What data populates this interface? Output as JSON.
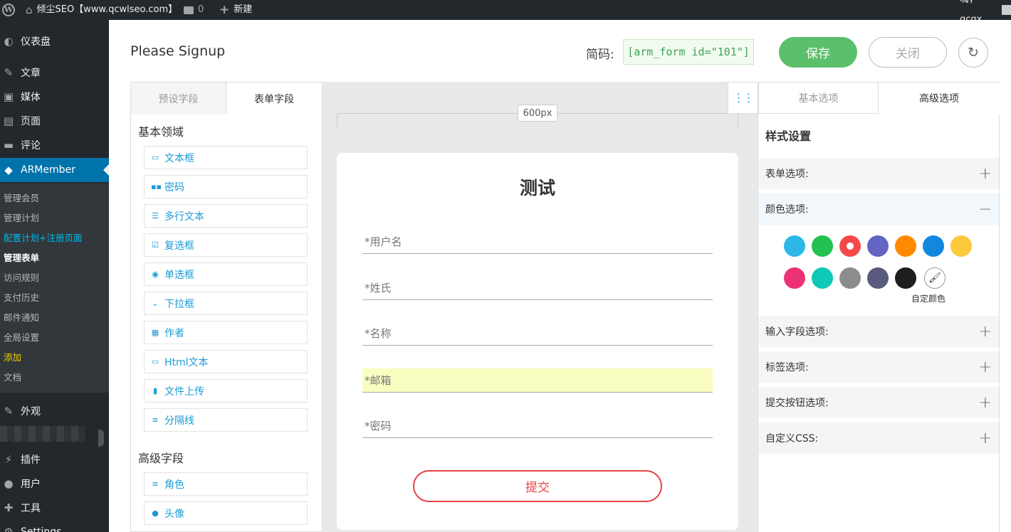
{
  "admin_bar": {
    "wp_logo": "W",
    "site_name": "倾尘SEO【www.qcwlseo.com】",
    "comments_count": "0",
    "new_label": "新建",
    "greeting": "嗨，qcqx"
  },
  "sidebar": {
    "items": [
      {
        "label": "仪表盘",
        "icon": "dashboard-icon"
      },
      {
        "label": "文章",
        "icon": "pin-icon"
      },
      {
        "label": "媒体",
        "icon": "media-icon"
      },
      {
        "label": "页面",
        "icon": "page-icon"
      },
      {
        "label": "评论",
        "icon": "comment-icon"
      },
      {
        "label": "ARMember",
        "icon": "armember-icon"
      },
      {
        "label": "外观",
        "icon": "appearance-icon"
      },
      {
        "label": "插件",
        "icon": "plugin-icon"
      },
      {
        "label": "用户",
        "icon": "user-icon"
      },
      {
        "label": "工具",
        "icon": "wrench-icon"
      },
      {
        "label": "Settings",
        "icon": "settings-icon"
      }
    ],
    "submenu": [
      "管理会员",
      "管理计划",
      "配置计划+注册页面",
      "管理表单",
      "访问规则",
      "支付历史",
      "邮件通知",
      "全局设置",
      "添加",
      "文档"
    ]
  },
  "header": {
    "form_title": "Please Signup",
    "shortcode_label": "简码:",
    "shortcode_value": "[arm_form id=\"101\"]",
    "save_label": "保存",
    "close_label": "关闭"
  },
  "field_panel": {
    "tabs": [
      "预设字段",
      "表单字段"
    ],
    "basic_title": "基本领域",
    "basic_fields": [
      {
        "label": "文本框",
        "icon": "textbox-icon"
      },
      {
        "label": "密码",
        "icon": "password-icon"
      },
      {
        "label": "多行文本",
        "icon": "textarea-icon"
      },
      {
        "label": "复选框",
        "icon": "checkbox-icon"
      },
      {
        "label": "单选框",
        "icon": "radio-icon"
      },
      {
        "label": "下拉框",
        "icon": "dropdown-icon"
      },
      {
        "label": "作者",
        "icon": "calendar-icon"
      },
      {
        "label": "Html文本",
        "icon": "html-icon"
      },
      {
        "label": "文件上传",
        "icon": "upload-icon"
      },
      {
        "label": "分隔线",
        "icon": "divider-icon"
      }
    ],
    "advanced_title": "高级字段",
    "advanced_fields": [
      {
        "label": "角色",
        "icon": "role-icon"
      },
      {
        "label": "头像",
        "icon": "avatar-icon"
      }
    ]
  },
  "canvas": {
    "width_label": "600px",
    "form_heading": "测试",
    "fields": [
      "*用户名",
      "*姓氏",
      "*名称",
      "*邮箱",
      "*密码"
    ],
    "submit_label": "提交"
  },
  "settings_panel": {
    "tabs": [
      "基本选项",
      "高级选项"
    ],
    "style_title": "样式设置",
    "options": [
      {
        "label": "表单选项:",
        "toggle": "+"
      },
      {
        "label": "颜色选项:",
        "toggle": "−"
      },
      {
        "label": "输入字段选项:",
        "toggle": "+"
      },
      {
        "label": "标签选项:",
        "toggle": "+"
      },
      {
        "label": "提交按钮选项:",
        "toggle": "+"
      },
      {
        "label": "自定义CSS:",
        "toggle": "+"
      }
    ],
    "color_swatches": [
      "#2bb7e8",
      "#22c150",
      "#f54848",
      "#6464c4",
      "#ff8a00",
      "#1386e0",
      "#fcc93b",
      "#ec3275",
      "#10c8b6",
      "#8c8c8c",
      "#5a5a7e",
      "#1e1e1e"
    ],
    "selected_swatch": "#f54848",
    "custom_color_label": "自定颜色"
  }
}
